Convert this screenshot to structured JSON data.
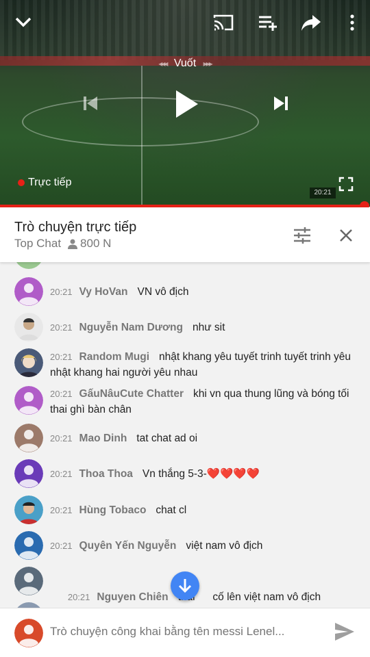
{
  "player": {
    "seek_label": "Vuốt",
    "seek_left_arrows": "◂◂◂",
    "seek_right_arrows": "▸▸▸",
    "live_label": "Trực tiếp",
    "clock": "20:21",
    "icons": [
      "chevron-down-icon",
      "cast-icon",
      "add-to-playlist-icon",
      "share-icon",
      "more-vert-icon",
      "skip-previous-icon",
      "play-icon",
      "skip-next-icon",
      "fullscreen-icon"
    ],
    "accent_color": "#e62117"
  },
  "chat_header": {
    "title": "Trò chuyện trực tiếp",
    "mode": "Top Chat",
    "viewers": "800 N"
  },
  "messages": [
    {
      "time": "20:21",
      "author": "Vy HoVan",
      "text": "VN vô địch",
      "avatar_color": "#b05cc8"
    },
    {
      "time": "20:21",
      "author": "Nguyễn Nam Dương",
      "text": "như sit",
      "avatar_color": "#9aa0a6"
    },
    {
      "time": "20:21",
      "author": "Random Mugi",
      "text": "nhật khang yêu tuyết trinh tuyết trinh yêu nhật khang hai người yêu nhau",
      "avatar_color": "#6a7a9a"
    },
    {
      "time": "20:21",
      "author": "GấuNâuCute Chatter",
      "text": "khi vn qua thung lũng và bóng tối thai ghì bàn chân",
      "avatar_color": "#b05cc8"
    },
    {
      "time": "20:21",
      "author": "Mao Dinh",
      "text": "tat chat ad oi",
      "avatar_color": "#9c7a6a"
    },
    {
      "time": "20:21",
      "author": "Thoa Thoa",
      "text": "Vn thắng 5-3-❤️❤️❤️❤️",
      "avatar_color": "#6a3bb8"
    },
    {
      "time": "20:21",
      "author": "Hùng Tobaco",
      "text": "chat cl",
      "avatar_color": "#4aa0c8"
    },
    {
      "time": "20:21",
      "author": "Quyên Yến Nguyễn",
      "text": "việt nam vô địch",
      "avatar_color": "#2a6bb0"
    },
    {
      "time": "20:21",
      "author": "Nguyen Chiên",
      "text": "thái      cố lên việt nam vô địch",
      "avatar_color": "#5a6a7a"
    }
  ],
  "input": {
    "placeholder": "Trò chuyện công khai bằng tên messi Lenel...",
    "avatar_color": "#d84a2a"
  }
}
